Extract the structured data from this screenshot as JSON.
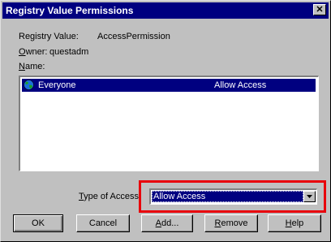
{
  "window": {
    "title": "Registry Value Permissions",
    "close_label": "✕"
  },
  "registry_value": {
    "label": "Registry Value:",
    "value": "AccessPermission"
  },
  "owner": {
    "label_prefix": "O",
    "label_rest": "wner:",
    "value": "questadm"
  },
  "name_label": {
    "prefix": "N",
    "rest": "ame:"
  },
  "entries": [
    {
      "icon": "globe-icon",
      "name": "Everyone",
      "access": "Allow Access"
    }
  ],
  "type_of_access": {
    "label_prefix": "T",
    "label_rest": "ype of Access:",
    "selected": "Allow Access"
  },
  "buttons": {
    "ok": "OK",
    "cancel": "Cancel",
    "add_prefix": "A",
    "add_rest": "dd...",
    "remove_prefix": "R",
    "remove_rest": "emove",
    "help_prefix": "H",
    "help_rest": "elp"
  },
  "colors": {
    "titlebar": "#000080",
    "selection": "#000080",
    "highlight_box": "#e8000b",
    "face": "#c0c0c0"
  }
}
